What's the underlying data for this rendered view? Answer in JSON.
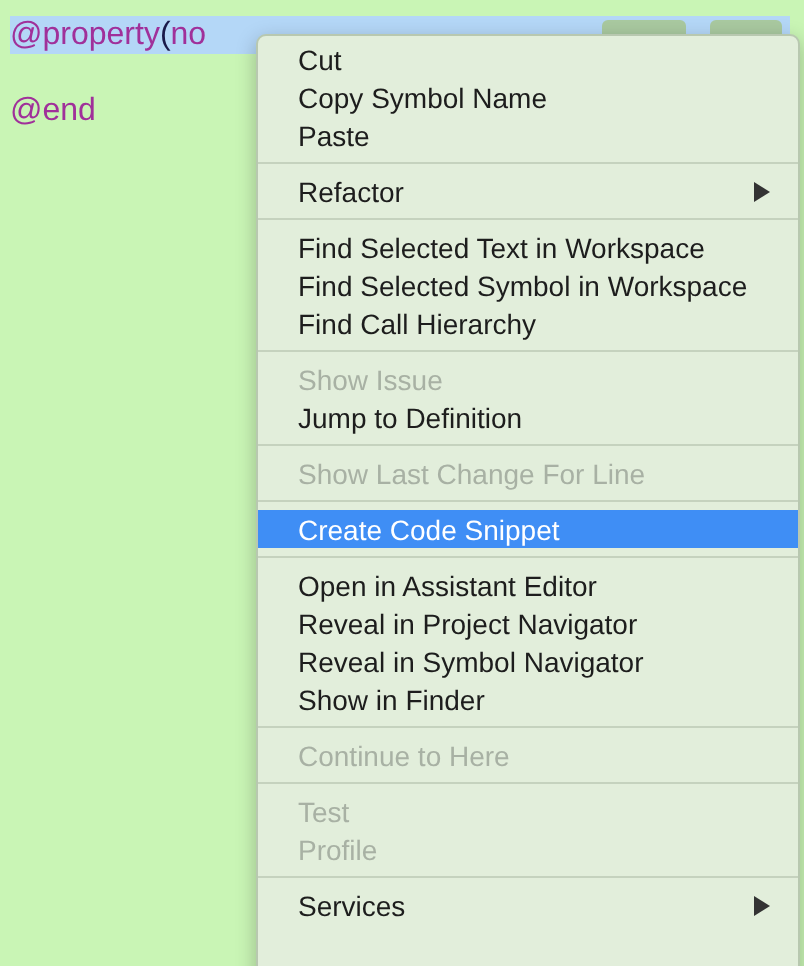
{
  "editor": {
    "lines": [
      {
        "selected": true,
        "segments": [
          {
            "kind": "keyword",
            "text": "@property"
          },
          {
            "kind": "bracket",
            "text": "("
          },
          {
            "kind": "keyword",
            "text": "no"
          }
        ]
      },
      {
        "selected": false,
        "segments": [
          {
            "kind": "keyword",
            "text": "@end"
          }
        ]
      }
    ]
  },
  "context_menu": {
    "items": [
      {
        "kind": "item",
        "label": "Cut",
        "disabled": false,
        "selected": false,
        "submenu": false
      },
      {
        "kind": "item",
        "label": "Copy Symbol Name",
        "disabled": false,
        "selected": false,
        "submenu": false
      },
      {
        "kind": "item",
        "label": "Paste",
        "disabled": false,
        "selected": false,
        "submenu": false
      },
      {
        "kind": "separator"
      },
      {
        "kind": "item",
        "label": "Refactor",
        "disabled": false,
        "selected": false,
        "submenu": true
      },
      {
        "kind": "separator"
      },
      {
        "kind": "item",
        "label": "Find Selected Text in Workspace",
        "disabled": false,
        "selected": false,
        "submenu": false
      },
      {
        "kind": "item",
        "label": "Find Selected Symbol in Workspace",
        "disabled": false,
        "selected": false,
        "submenu": false
      },
      {
        "kind": "item",
        "label": "Find Call Hierarchy",
        "disabled": false,
        "selected": false,
        "submenu": false
      },
      {
        "kind": "separator"
      },
      {
        "kind": "item",
        "label": "Show Issue",
        "disabled": true,
        "selected": false,
        "submenu": false
      },
      {
        "kind": "item",
        "label": "Jump to Definition",
        "disabled": false,
        "selected": false,
        "submenu": false
      },
      {
        "kind": "separator"
      },
      {
        "kind": "item",
        "label": "Show Last Change For Line",
        "disabled": true,
        "selected": false,
        "submenu": false
      },
      {
        "kind": "separator"
      },
      {
        "kind": "item",
        "label": "Create Code Snippet",
        "disabled": false,
        "selected": true,
        "submenu": false
      },
      {
        "kind": "separator"
      },
      {
        "kind": "item",
        "label": "Open in Assistant Editor",
        "disabled": false,
        "selected": false,
        "submenu": false
      },
      {
        "kind": "item",
        "label": "Reveal in Project Navigator",
        "disabled": false,
        "selected": false,
        "submenu": false
      },
      {
        "kind": "item",
        "label": "Reveal in Symbol Navigator",
        "disabled": false,
        "selected": false,
        "submenu": false
      },
      {
        "kind": "item",
        "label": "Show in Finder",
        "disabled": false,
        "selected": false,
        "submenu": false
      },
      {
        "kind": "separator"
      },
      {
        "kind": "item",
        "label": "Continue to Here",
        "disabled": true,
        "selected": false,
        "submenu": false
      },
      {
        "kind": "separator"
      },
      {
        "kind": "item",
        "label": "Test",
        "disabled": true,
        "selected": false,
        "submenu": false
      },
      {
        "kind": "item",
        "label": "Profile",
        "disabled": true,
        "selected": false,
        "submenu": false
      },
      {
        "kind": "separator"
      },
      {
        "kind": "item",
        "label": "Services",
        "disabled": false,
        "selected": false,
        "submenu": true
      }
    ]
  }
}
